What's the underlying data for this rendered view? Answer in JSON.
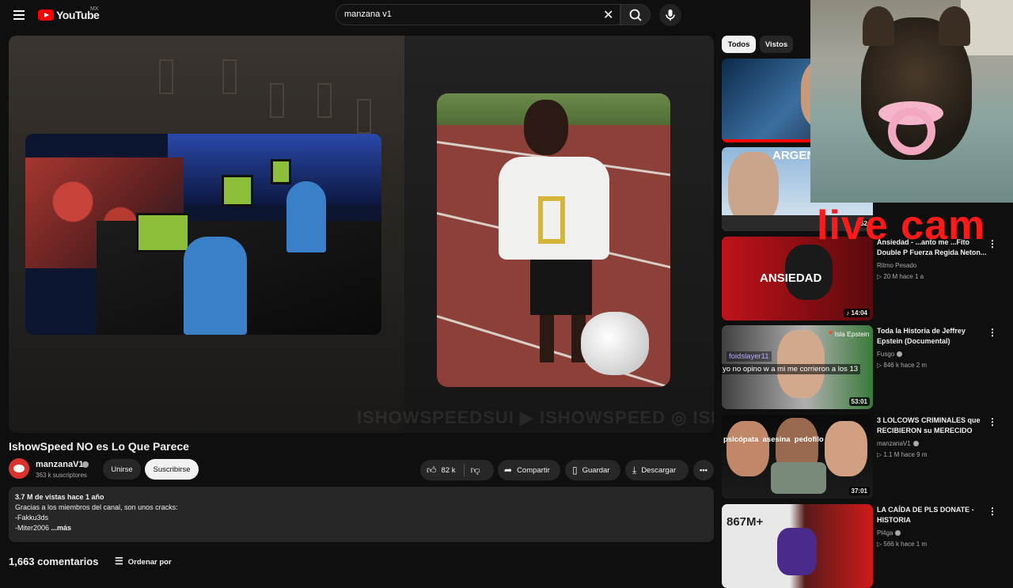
{
  "header": {
    "logo_text": "YouTube",
    "country": "MX",
    "search_value": "manzana v1"
  },
  "video": {
    "title": "IshowSpeed NO es Lo Que Parece",
    "watermark": "ISHOWSPEEDSUI ▶ ISHOWSPEED ◎ ISHOWSPEED",
    "channel_name": "manzanaV1",
    "subscribers": "363 k suscriptores",
    "join_label": "Unirse",
    "subscribe_label": "Suscribirse",
    "likes": "82 k",
    "share_label": "Compartir",
    "save_label": "Guardar",
    "download_label": "Descargar"
  },
  "description": {
    "meta": "3.7 M de vistas  hace 1 año",
    "line1": "Gracias a los miembros del canal, son unos cracks:",
    "line2": "-Fakku3ds",
    "line3": "-Miter2006",
    "more": "...más"
  },
  "comments": {
    "count_label": "1,663 comentarios",
    "sort_label": "Ordenar por"
  },
  "chips": [
    {
      "label": "Todos",
      "active": true
    },
    {
      "label": "Vistos",
      "active": false
    }
  ],
  "recommendations": [
    {
      "title": "",
      "channel": "",
      "meta": "",
      "duration": "",
      "thumb_text": ""
    },
    {
      "title": "",
      "channel": "",
      "meta": "",
      "duration": "52",
      "thumb_text": "ARGEN"
    },
    {
      "title": "Ansiedad - ...anto me ...Fito Double P Fuerza Regida Neton...",
      "channel": "Ritmo Pesado",
      "meta": "▷ 20 M  hace 1 a",
      "duration": "14:04",
      "thumb_text": "ANSIEDAD"
    },
    {
      "title": "Toda la Historia de Jeffrey Epstein (Documental)",
      "channel": "Fusgo",
      "meta": "▷ 846 k  hace 2 m",
      "duration": "53:01",
      "thumb_text": "Isla Epstein"
    },
    {
      "title": "3 LOLCOWS CRIMINALES que RECIBIERON su MERECIDO",
      "channel": "manzanaV1",
      "meta": "▷ 1.1 M  hace 9 m",
      "duration": "37:01",
      "thumb_text": "psicópata  asesina  pedofilo"
    },
    {
      "title": "LA CAÍDA DE PLS DONATE - HISTORIA",
      "channel": "Pl4ga",
      "meta": "▷ 566 k  hace 1 m",
      "duration": "",
      "thumb_text": "867M+"
    }
  ],
  "overlay": {
    "live_cam_text": "live cam",
    "chat_user": "foidslayer11",
    "chat_message": "yo no opino w a mi me corrieron a los 13"
  },
  "colors": {
    "background": "#0f0f0f",
    "brand_red": "#ff0000",
    "live_cam_red": "#ff1a1a"
  }
}
